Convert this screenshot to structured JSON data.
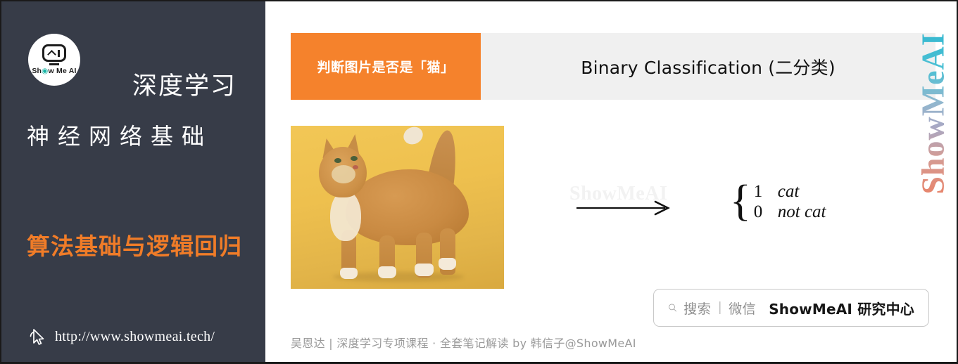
{
  "sidebar": {
    "logo": {
      "icon": "showmeai-robot-logo",
      "text_prefix": "Sh",
      "text_eye": "◉",
      "text_suffix": "w Me AI"
    },
    "title_line1": "深度学习",
    "title_line2": "神经网络基础",
    "subtitle": "算法基础与逻辑回归",
    "cursor_icon": "click-pointer-icon",
    "site_url": "http://www.showmeai.tech/",
    "colors": {
      "background": "#373c48",
      "accent_orange": "#f07c28",
      "text": "#ffffff"
    }
  },
  "content": {
    "header": {
      "tag_label": "判断图片是否是「猫」",
      "title": "Binary Classification (二分类)",
      "tag_color": "#f5822c",
      "band_color": "#f0f0f0"
    },
    "vertical_watermark": "ShowMeAI",
    "center_watermark": "ShowMeAI",
    "cat_image": {
      "alt": "orange-tabby-cat-on-yellow-background",
      "background_color": "#eec04e"
    },
    "arrow_icon": "right-arrow-icon",
    "math": {
      "brace": "{",
      "rows": [
        {
          "value": "1",
          "label": "cat"
        },
        {
          "value": "0",
          "label": "not cat"
        }
      ]
    },
    "search": {
      "icon": "search-icon",
      "label": "搜索",
      "divider": "|",
      "channel": "微信",
      "brand": "ShowMeAI 研究中心"
    },
    "footer": "吴恩达 | 深度学习专项课程 · 全套笔记解读  by 韩信子@ShowMeAI"
  }
}
